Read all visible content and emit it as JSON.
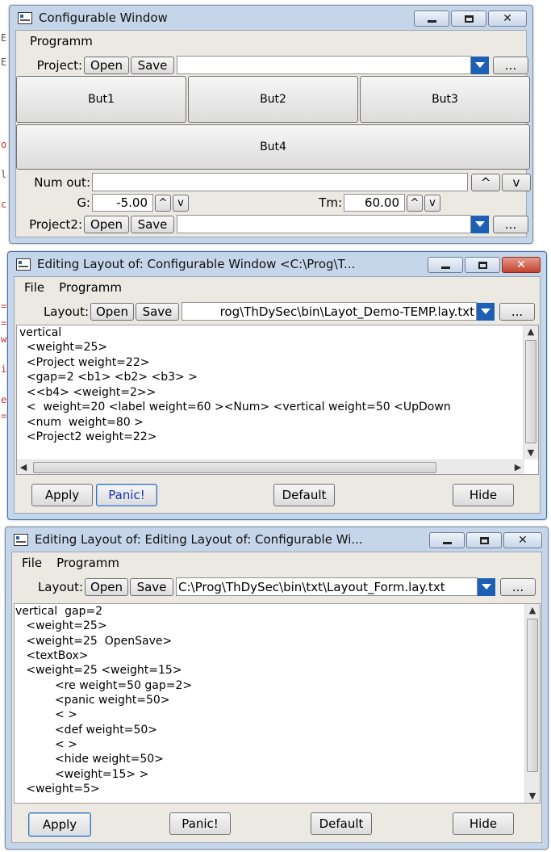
{
  "background_marks": [
    "=",
    "=",
    "w",
    "i",
    "e",
    "=",
    "o",
    "c",
    "l",
    "E",
    "E"
  ],
  "window1": {
    "title": "Configurable Window",
    "menu": [
      "Programm"
    ],
    "project_label": "Project:",
    "open_label": "Open",
    "save_label": "Save",
    "project_value": "",
    "browse_label": "...",
    "buttons_row": [
      "But1",
      "But2",
      "But3"
    ],
    "but4_label": "But4",
    "num_out_label": "Num out:",
    "num_out_value": "",
    "up_label": "^",
    "down_label": "v",
    "g_label": "G:",
    "g_value": "-5.00",
    "tm_label": "Tm:",
    "tm_value": "60.00",
    "project2_label": "Project2:",
    "project2_value": ""
  },
  "window2": {
    "title": "Editing Layout of: Configurable Window <C:\\Prog\\T...",
    "menu": [
      "File",
      "Programm"
    ],
    "layout_label": "Layout:",
    "open_label": "Open",
    "save_label": "Save",
    "layout_value": "rog\\ThDySec\\bin\\Layot_Demo-TEMP.lay.txt",
    "browse_label": "...",
    "code_lines": [
      "vertical",
      "  <weight=25>",
      "  <Project weight=22>",
      "  <gap=2 <b1> <b2> <b3> >",
      "  <<b4> <weight=2>>",
      "  <  weight=20 <label weight=60 ><Num> <vertical weight=50 <UpDown",
      "  <num  weight=80 >",
      "  <Project2 weight=22>"
    ],
    "apply_label": "Apply",
    "panic_label": "Panic!",
    "default_label": "Default",
    "hide_label": "Hide"
  },
  "window3": {
    "title": "Editing Layout of: Editing Layout of: Configurable Wi...",
    "menu": [
      "File",
      "Programm"
    ],
    "layout_label": "Layout:",
    "open_label": "Open",
    "save_label": "Save",
    "layout_value": "C:\\Prog\\ThDySec\\bin\\txt\\Layout_Form.lay.txt",
    "browse_label": "...",
    "code_lines": [
      "vertical  gap=2",
      "   <weight=25>",
      "   <weight=25  OpenSave>",
      "   <textBox>",
      "   <weight=25 <weight=15>",
      "           <re weight=50 gap=2>",
      "           <panic weight=50>",
      "           < >",
      "           <def weight=50>",
      "           < >",
      "           <hide weight=50>",
      "           <weight=15> >",
      "   <weight=5>"
    ],
    "apply_label": "Apply",
    "panic_label": "Panic!",
    "default_label": "Default",
    "hide_label": "Hide"
  }
}
